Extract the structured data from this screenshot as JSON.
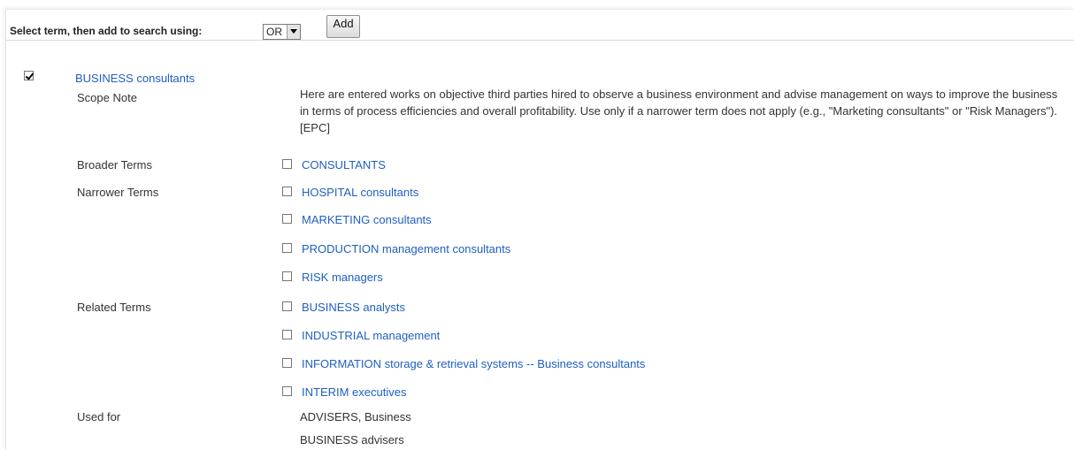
{
  "toolbar": {
    "label": "Select term, then add to search using:",
    "operator_value": "OR",
    "add_label": "Add"
  },
  "main_term": {
    "label": "BUSINESS consultants",
    "checked": true
  },
  "scope_note": {
    "label": "Scope Note",
    "text": "Here are entered works on objective third parties hired to observe a business environment and advise management on ways to improve the business in terms of process efficiencies and overall profitability. Use only if a narrower term does not apply (e.g., \"Marketing consultants\" or \"Risk Managers\"). [EPC]"
  },
  "broader": {
    "label": "Broader Terms",
    "terms": [
      "CONSULTANTS"
    ]
  },
  "narrower": {
    "label": "Narrower Terms",
    "terms": [
      "HOSPITAL consultants",
      "MARKETING consultants",
      "PRODUCTION management consultants",
      "RISK managers"
    ]
  },
  "related": {
    "label": "Related Terms",
    "terms": [
      "BUSINESS analysts",
      "INDUSTRIAL management",
      "INFORMATION storage & retrieval systems -- Business consultants",
      "INTERIM executives"
    ]
  },
  "used_for": {
    "label": "Used for",
    "terms": [
      "ADVISERS, Business",
      "BUSINESS advisers"
    ]
  },
  "colors": {
    "link": "#1f5fc0",
    "text": "#333333"
  }
}
